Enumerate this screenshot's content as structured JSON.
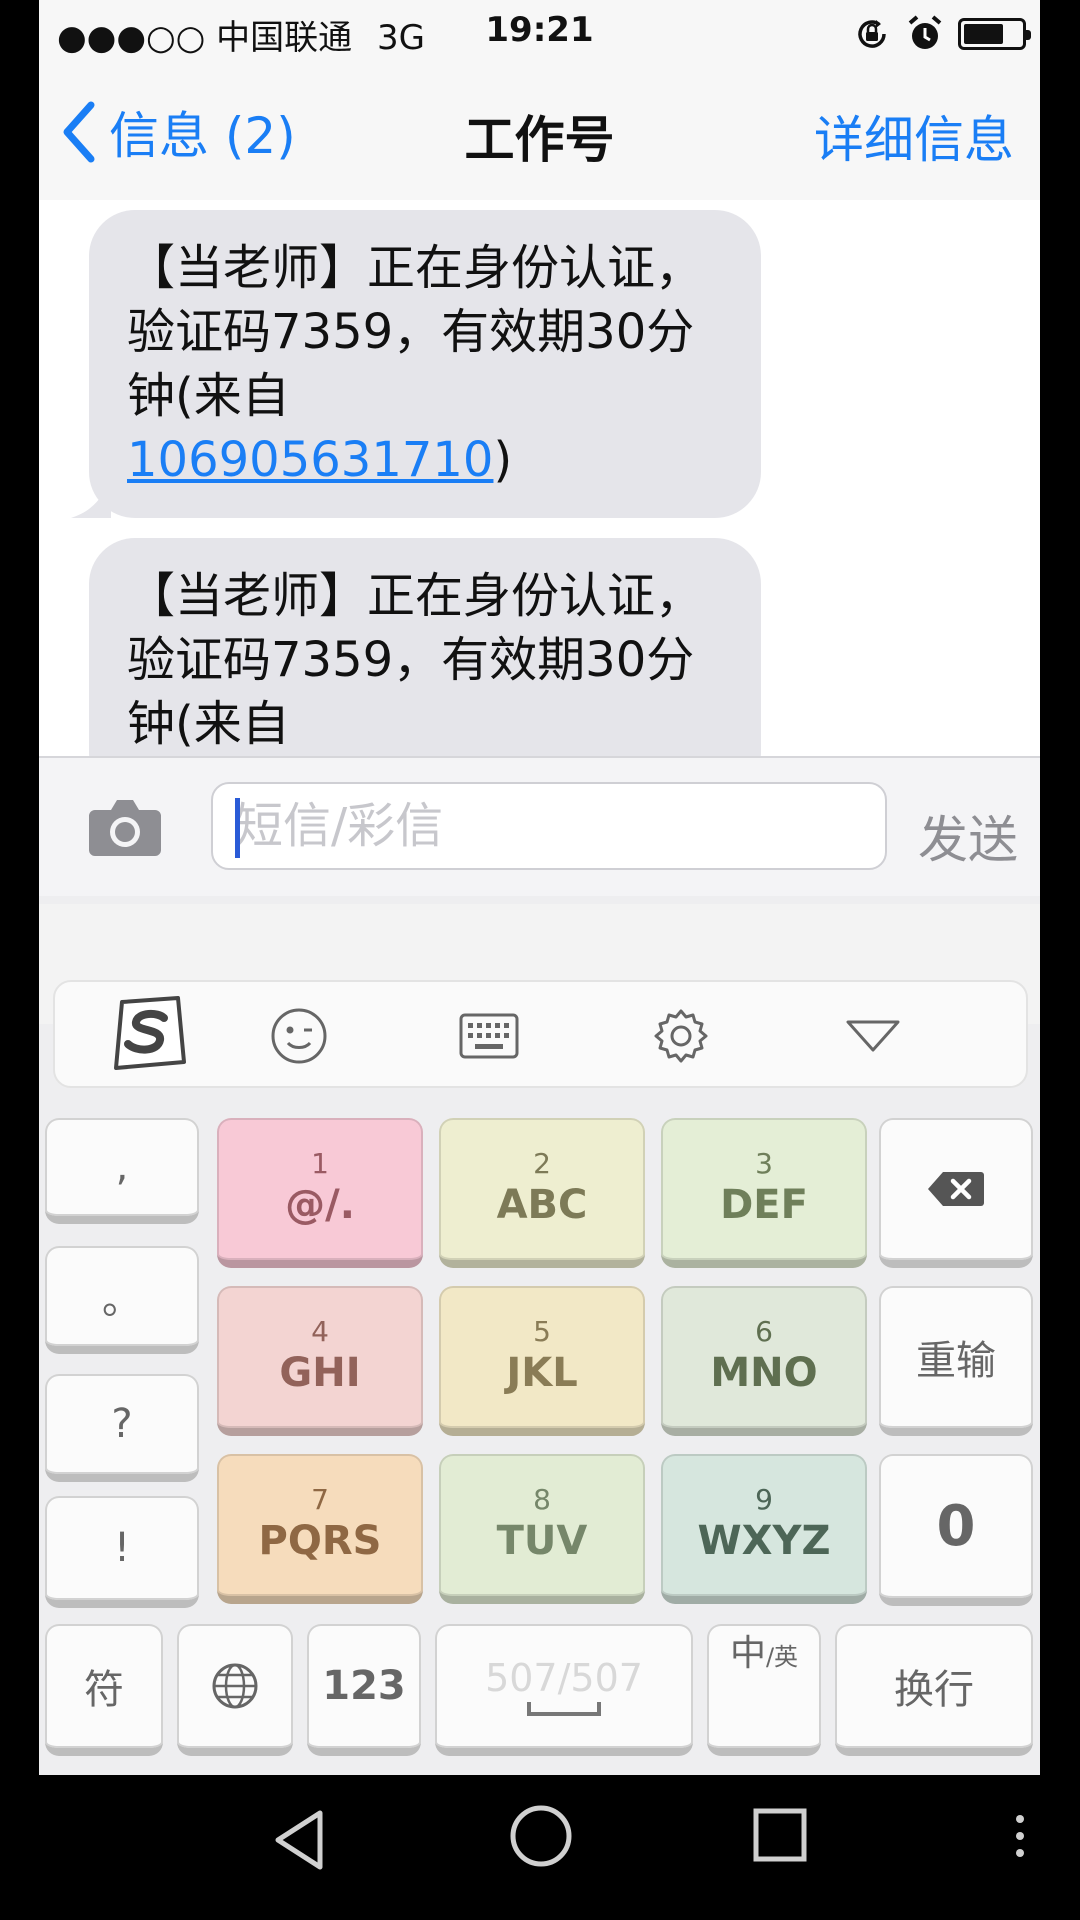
{
  "status": {
    "signal": "●●●○○",
    "carrier": "中国联通",
    "network": "3G",
    "time": "19:21",
    "battery_level": 0.7
  },
  "nav": {
    "back_label": "信息 (2)",
    "title": "工作号",
    "detail_label": "详细信息"
  },
  "messages": [
    {
      "text": "【当老师】正在身份认证，验证码7359，有效期30分钟(来自",
      "link": "106905631710",
      "suffix": ")"
    },
    {
      "text": "【当老师】正在身份认证，验证码7359，有效期30分钟(来自"
    }
  ],
  "input": {
    "placeholder": "短信/彩信",
    "send_label": "发送"
  },
  "keyboard": {
    "punct": [
      ",",
      "。",
      "?",
      "!"
    ],
    "keys": [
      {
        "num": "1",
        "letters": "@/.",
        "color": "#f8c9d6",
        "text_color": "#9a5a63"
      },
      {
        "num": "2",
        "letters": "ABC",
        "color": "#eeeed0",
        "text_color": "#7d7a57"
      },
      {
        "num": "3",
        "letters": "DEF",
        "color": "#e4eed6",
        "text_color": "#6f7f5a"
      },
      {
        "num": "4",
        "letters": "GHI",
        "color": "#f3d4d2",
        "text_color": "#92625a"
      },
      {
        "num": "5",
        "letters": "JKL",
        "color": "#f2e8c6",
        "text_color": "#8a7c56"
      },
      {
        "num": "6",
        "letters": "MNO",
        "color": "#e0e8da",
        "text_color": "#5f6f50"
      },
      {
        "num": "7",
        "letters": "PQRS",
        "color": "#f6dcbc",
        "text_color": "#8f6844"
      },
      {
        "num": "8",
        "letters": "TUV",
        "color": "#e2ecd4",
        "text_color": "#76876a"
      },
      {
        "num": "9",
        "letters": "WXYZ",
        "color": "#d6e6de",
        "text_color": "#4d6657"
      }
    ],
    "delete_icon": "backspace-icon",
    "reset_label": "重输",
    "zero_label": "0",
    "sym_label": "符",
    "num_label": "123",
    "space_label": "507/507",
    "lang_main": "中",
    "lang_sub": "/英",
    "enter_label": "换行"
  }
}
